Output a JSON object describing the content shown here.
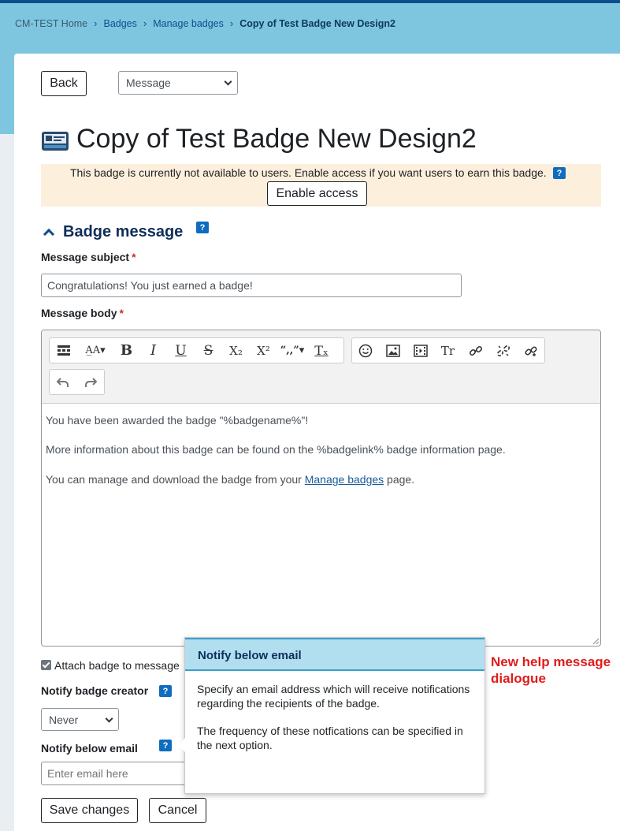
{
  "breadcrumb": {
    "home": "CM-TEST Home",
    "badges": "Badges",
    "manage": "Manage badges",
    "current": "Copy of Test Badge New Design2"
  },
  "nav": {
    "back_label": "Back",
    "select_value": "Message"
  },
  "page": {
    "title": "Copy of Test Badge New Design2"
  },
  "notice": {
    "text": "This badge is currently not available to users. Enable access if you want users to earn this badge.",
    "enable_label": "Enable access"
  },
  "help_glyph": "?",
  "section": {
    "title": "Badge message"
  },
  "subject": {
    "label": "Message subject",
    "value": "Congratulations! You just earned a badge!"
  },
  "body": {
    "label": "Message body",
    "line1": "You have been awarded the badge \"%badgename%\"!",
    "line2": "More information about this badge can be found on the %badgelink% badge information page.",
    "line3_pre": "You can manage and download the badge from your ",
    "line3_link": "Manage badges",
    "line3_post": " page."
  },
  "toolbar": {
    "bold": "B",
    "italic": "I",
    "underline": "U",
    "strike": "S",
    "sub": "X₂",
    "sup": "X²",
    "quote": "“,,”▾",
    "clear": "Tₓ",
    "textstyle": "Tr",
    "fontsize": "A̲A▾",
    "icons": [
      "toggle-toolbar-icon",
      "font-size-icon",
      "bold-icon",
      "italic-icon",
      "underline-icon",
      "strikethrough-icon",
      "subscript-icon",
      "superscript-icon",
      "blockquote-icon",
      "clear-format-icon",
      "emoji-icon",
      "image-icon",
      "media-icon",
      "text-style-icon",
      "link-icon",
      "unlink-icon",
      "special-link-icon",
      "undo-icon",
      "redo-icon"
    ]
  },
  "attach": {
    "label": "Attach badge to message"
  },
  "notify_creator": {
    "label": "Notify badge creator",
    "value": "Never"
  },
  "notify_email": {
    "label": "Notify below email",
    "placeholder": "Enter email here"
  },
  "popup": {
    "title": "Notify below email",
    "para1": "Specify an email address which will receive notifications regarding the recipients of the badge.",
    "para2": "The frequency of these notfications can be specified in the next option."
  },
  "annotation": {
    "line1": "New help message",
    "line2": "dialogue"
  },
  "actions": {
    "save_label": "Save changes",
    "cancel_label": "Cancel"
  },
  "colors": {
    "banner": "#7ec6e0",
    "accent": "#0f6cbf",
    "notice_bg": "#fcefdc",
    "popup_head": "#b1dff0",
    "annotation": "#e11b1b"
  }
}
